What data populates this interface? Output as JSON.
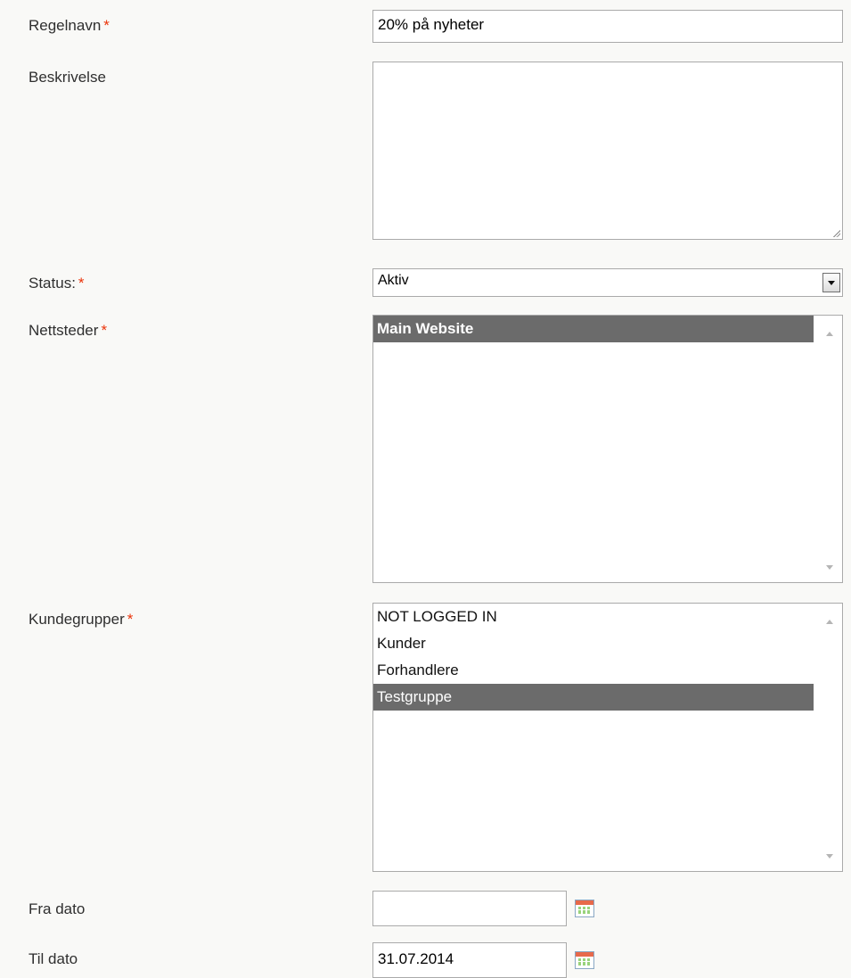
{
  "form": {
    "rule_name": {
      "label": "Regelnavn",
      "required_mark": "*",
      "value": "20% på nyheter"
    },
    "description": {
      "label": "Beskrivelse",
      "value": ""
    },
    "status": {
      "label": "Status:",
      "required_mark": "*",
      "selected": "Aktiv"
    },
    "websites": {
      "label": "Nettsteder",
      "required_mark": "*",
      "options": [
        {
          "label": "Main Website",
          "selected": true
        }
      ]
    },
    "customer_groups": {
      "label": "Kundegrupper",
      "required_mark": "*",
      "options": [
        {
          "label": "NOT LOGGED IN",
          "selected": false
        },
        {
          "label": "Kunder",
          "selected": false
        },
        {
          "label": "Forhandlere",
          "selected": false
        },
        {
          "label": "Testgruppe",
          "selected": true
        }
      ]
    },
    "from_date": {
      "label": "Fra dato",
      "value": ""
    },
    "to_date": {
      "label": "Til dato",
      "value": "31.07.2014"
    }
  },
  "icons": {
    "calendar": "calendar-icon",
    "select_arrow": "chevron-down-icon",
    "resize": "resize-grip-icon",
    "scroll_up": "scroll-up-icon",
    "scroll_down": "scroll-down-icon"
  },
  "colors": {
    "required_star": "#eb340a",
    "selected_option_bg": "#6b6b6b",
    "page_bg": "#f9f9f7"
  }
}
